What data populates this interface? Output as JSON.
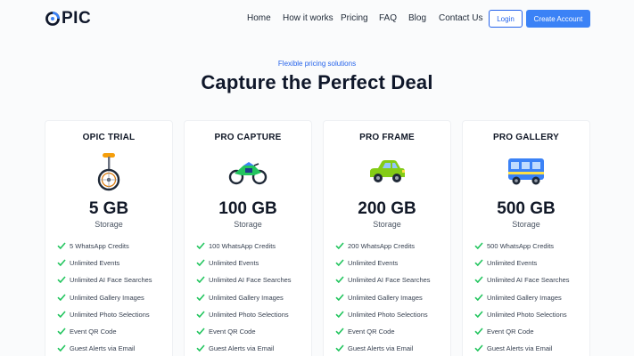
{
  "brand": {
    "name": "PIC"
  },
  "nav": {
    "items": [
      "Home",
      "How it works",
      "Pricing",
      "FAQ",
      "Blog",
      "Contact Us"
    ],
    "login": "Login",
    "create": "Create Account"
  },
  "hero": {
    "eyebrow": "Flexible pricing solutions",
    "title": "Capture the Perfect Deal"
  },
  "colors": {
    "accent": "#2563eb",
    "check": "#22c55e"
  },
  "plans": [
    {
      "name": "OPIC TRIAL",
      "icon": "unicycle-icon",
      "size": "5 GB",
      "unit": "Storage",
      "features": [
        "5 WhatsApp Credits",
        "Unlimited Events",
        "Unlimited AI Face Searches",
        "Unlimited Gallery Images",
        "Unlimited Photo Selections",
        "Event QR Code",
        "Guest Alerts via Email"
      ]
    },
    {
      "name": "PRO CAPTURE",
      "icon": "motorbike-icon",
      "size": "100 GB",
      "unit": "Storage",
      "features": [
        "100 WhatsApp Credits",
        "Unlimited Events",
        "Unlimited AI Face Searches",
        "Unlimited Gallery Images",
        "Unlimited Photo Selections",
        "Event QR Code",
        "Guest Alerts via Email"
      ]
    },
    {
      "name": "PRO FRAME",
      "icon": "car-icon",
      "size": "200 GB",
      "unit": "Storage",
      "features": [
        "200 WhatsApp Credits",
        "Unlimited Events",
        "Unlimited AI Face Searches",
        "Unlimited Gallery Images",
        "Unlimited Photo Selections",
        "Event QR Code",
        "Guest Alerts via Email"
      ]
    },
    {
      "name": "PRO GALLERY",
      "icon": "bus-icon",
      "size": "500 GB",
      "unit": "Storage",
      "features": [
        "500 WhatsApp Credits",
        "Unlimited Events",
        "Unlimited AI Face Searches",
        "Unlimited Gallery Images",
        "Unlimited Photo Selections",
        "Event QR Code",
        "Guest Alerts via Email"
      ]
    }
  ]
}
